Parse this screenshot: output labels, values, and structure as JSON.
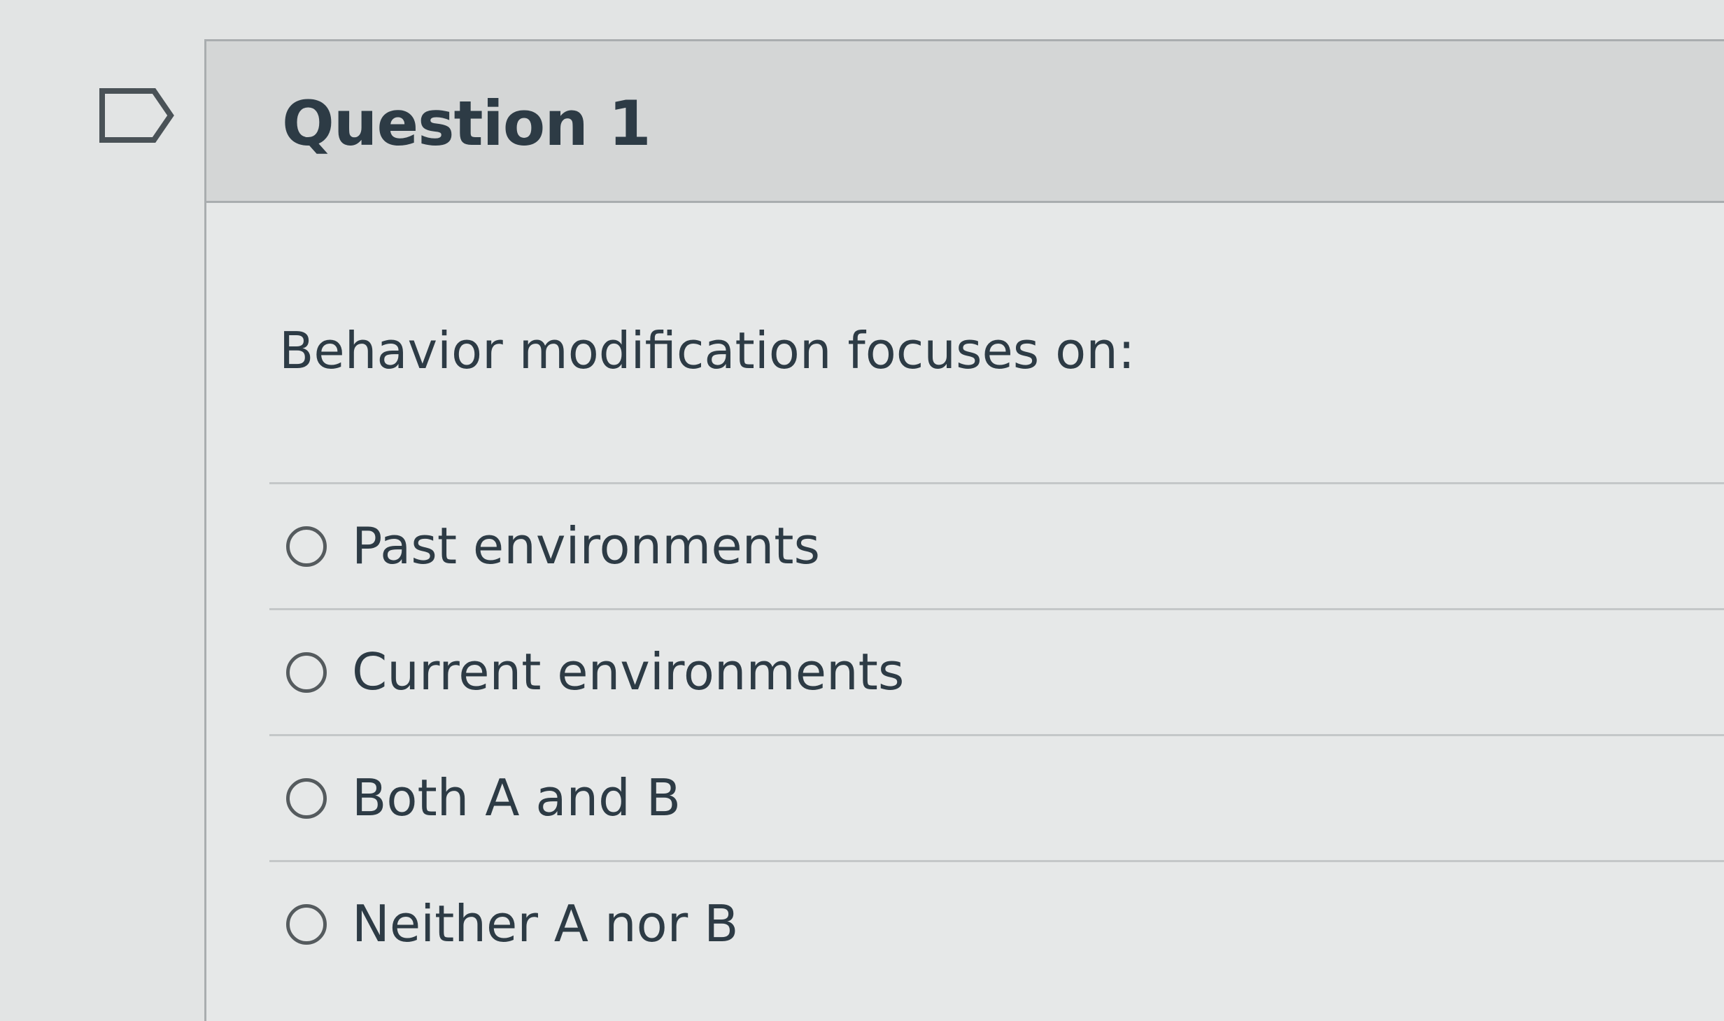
{
  "question": {
    "title": "Question 1",
    "text": "Behavior modification focuses on:",
    "flag_icon": "flag-outline-icon",
    "answers": [
      {
        "label": "Past environments",
        "selected": false
      },
      {
        "label": "Current environments",
        "selected": false
      },
      {
        "label": "Both A and B",
        "selected": false
      },
      {
        "label": "Neither A nor B",
        "selected": false
      }
    ]
  },
  "colors": {
    "text": "#2d3b45",
    "header_background": "#d4d6d6",
    "border": "#a9adaf"
  }
}
